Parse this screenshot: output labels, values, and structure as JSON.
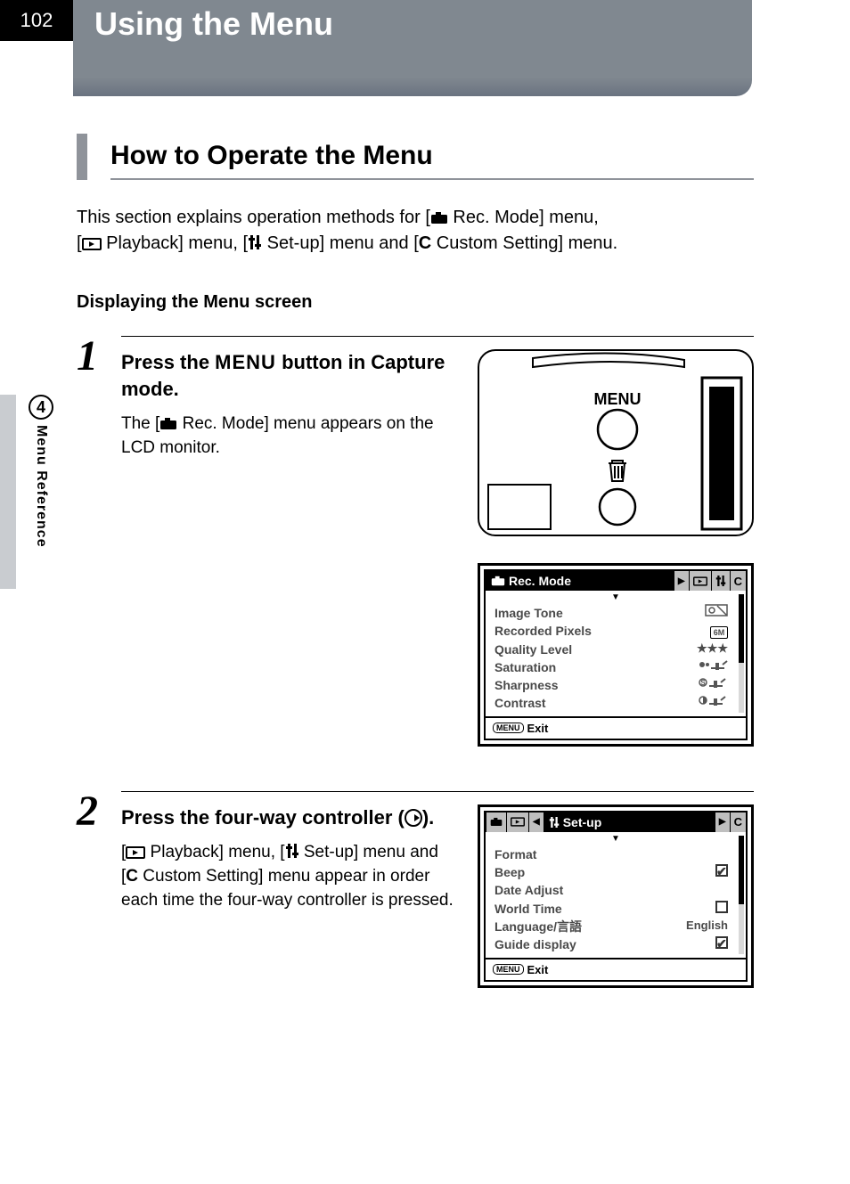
{
  "page_number": "102",
  "chapter_title": "Using the Menu",
  "side": {
    "chapter_num": "4",
    "label": "Menu Reference"
  },
  "subhead": "How to Operate the Menu",
  "intro": {
    "line1a": "This section explains operation methods for [",
    "line1b": " Rec. Mode] menu,",
    "line2a": "[",
    "line2b": " Playback] menu, [",
    "line2c": " Set-up] menu and [",
    "line2d": " Custom Setting] menu.",
    "custom_letter": "C"
  },
  "section_label": "Displaying the Menu screen",
  "step1": {
    "num": "1",
    "title_a": "Press the ",
    "title_b": "MENU",
    "title_c": " button in Capture mode.",
    "desc_a": "The [",
    "desc_b": " Rec. Mode] menu appears on the LCD monitor.",
    "camera_label": "MENU"
  },
  "lcd_rec": {
    "tab_title": "Rec. Mode",
    "other_tab_c": "C",
    "rows": [
      {
        "label": "Image Tone",
        "val": ""
      },
      {
        "label": "Recorded Pixels",
        "val": "6M"
      },
      {
        "label": "Quality Level",
        "val": "★★★"
      },
      {
        "label": "Saturation",
        "val": ""
      },
      {
        "label": "Sharpness",
        "val": ""
      },
      {
        "label": "Contrast",
        "val": ""
      }
    ],
    "exit": "Exit"
  },
  "step2": {
    "num": "2",
    "title": "Press the four-way controller (   ).",
    "title_a": "Press the four-way controller (",
    "title_b": ").",
    "desc_a": "[",
    "desc_b": " Playback] menu, [",
    "desc_c": " Set-up] menu and [",
    "desc_d": " Custom Setting] menu appear in order each time the four-way controller is pressed.",
    "custom_letter": "C"
  },
  "lcd_setup": {
    "tab_title": "Set-up",
    "other_tab_c": "C",
    "rows": [
      {
        "label": "Format",
        "val": ""
      },
      {
        "label": "Beep",
        "val": "checked"
      },
      {
        "label": "Date Adjust",
        "val": ""
      },
      {
        "label": "World Time",
        "val": "unchecked"
      },
      {
        "label": "Language/言語",
        "val": "English"
      },
      {
        "label": "Guide display",
        "val": "checked"
      }
    ],
    "exit": "Exit"
  }
}
